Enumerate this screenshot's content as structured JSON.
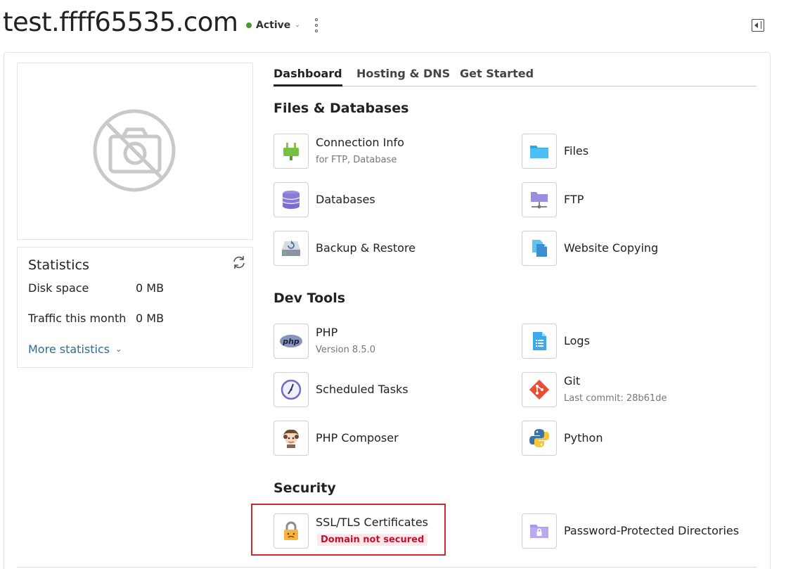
{
  "header": {
    "domain": "test.ffff65535.com",
    "status_label": "Active"
  },
  "tabs": [
    {
      "label": "Dashboard"
    },
    {
      "label": "Hosting & DNS"
    },
    {
      "label": "Get Started"
    }
  ],
  "statistics": {
    "title": "Statistics",
    "disk_label": "Disk space",
    "disk_value": "0 MB",
    "traffic_label": "Traffic this month",
    "traffic_value": "0 MB",
    "more_label": "More statistics"
  },
  "sections": {
    "files": {
      "title": "Files & Databases",
      "connection": {
        "label": "Connection Info",
        "sub": "for FTP, Database",
        "icon": "plug-icon"
      },
      "files": {
        "label": "Files",
        "icon": "folder-icon"
      },
      "databases": {
        "label": "Databases",
        "icon": "database-icon"
      },
      "ftp": {
        "label": "FTP",
        "icon": "ftp-icon"
      },
      "backup": {
        "label": "Backup & Restore",
        "icon": "backup-icon"
      },
      "copying": {
        "label": "Website Copying",
        "icon": "copy-icon"
      }
    },
    "dev": {
      "title": "Dev Tools",
      "php": {
        "label": "PHP",
        "sub": "Version 8.5.0",
        "icon": "php-icon"
      },
      "logs": {
        "label": "Logs",
        "icon": "logs-icon"
      },
      "tasks": {
        "label": "Scheduled Tasks",
        "icon": "clock-icon"
      },
      "git": {
        "label": "Git",
        "sub": "Last commit: 28b61de",
        "icon": "git-icon"
      },
      "composer": {
        "label": "PHP Composer",
        "icon": "composer-icon"
      },
      "python": {
        "label": "Python",
        "icon": "python-icon"
      }
    },
    "security": {
      "title": "Security",
      "ssl": {
        "label": "SSL/TLS Certificates",
        "badge": "Domain not secured",
        "icon": "lock-icon"
      },
      "ppd": {
        "label": "Password-Protected Directories",
        "icon": "locked-folder-icon"
      }
    }
  },
  "colors": {
    "status_active": "#4a9a2b",
    "link": "#2b6e98",
    "danger": "#c8102e",
    "highlight": "#d0282e"
  }
}
